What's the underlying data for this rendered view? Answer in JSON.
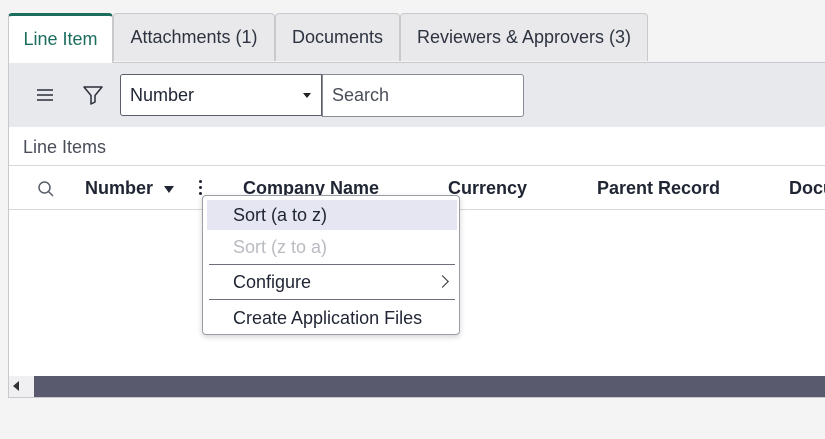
{
  "tabs": [
    {
      "label": "Line Item",
      "active": true
    },
    {
      "label": "Attachments (1)",
      "active": false
    },
    {
      "label": "Documents",
      "active": false
    },
    {
      "label": "Reviewers & Approvers (3)",
      "active": false
    }
  ],
  "toolbar": {
    "field_select_value": "Number",
    "search_placeholder": "Search",
    "menu_icon": "hamburger-icon",
    "filter_icon": "filter-icon"
  },
  "list": {
    "title": "Line Items",
    "columns": [
      "Number",
      "Company Name",
      "Currency",
      "Parent Record",
      "Docu"
    ]
  },
  "context_menu": {
    "items": [
      {
        "label": "Sort (a to z)",
        "state": "highlighted"
      },
      {
        "label": "Sort (z to a)",
        "state": "disabled"
      },
      {
        "label": "Configure",
        "state": "submenu"
      },
      {
        "label": "Create Application Files",
        "state": "normal"
      }
    ]
  },
  "colors": {
    "accent": "#1b6d5e",
    "toolbar_bg": "#e8e9ec",
    "scrollbar_thumb": "#5a5a6e",
    "menu_highlight": "#e6e6f2"
  }
}
